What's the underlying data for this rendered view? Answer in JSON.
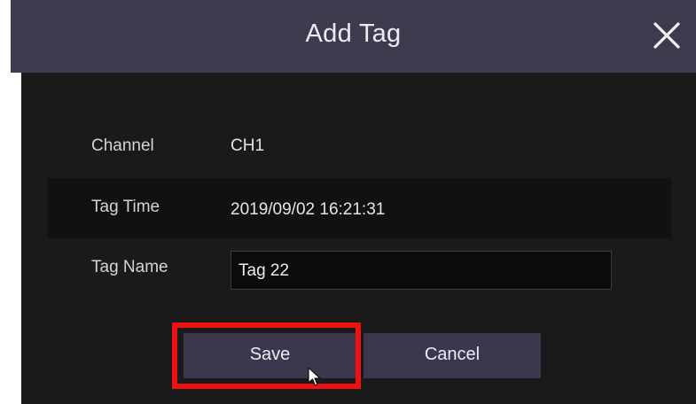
{
  "dialog": {
    "title": "Add Tag",
    "close_icon": "close-icon"
  },
  "fields": {
    "channel": {
      "label": "Channel",
      "value": "CH1"
    },
    "tag_time": {
      "label": "Tag Time",
      "value": "2019/09/02 16:21:31"
    },
    "tag_name": {
      "label": "Tag Name",
      "value": "Tag 22",
      "placeholder": ""
    }
  },
  "buttons": {
    "save_label": "Save",
    "cancel_label": "Cancel"
  },
  "annotation": {
    "highlight_target": "save-button",
    "highlight_color": "#ee1111"
  },
  "colors": {
    "title_bar": "#3e3b4f",
    "panel": "#1a1a1a",
    "button": "#3b384e"
  }
}
